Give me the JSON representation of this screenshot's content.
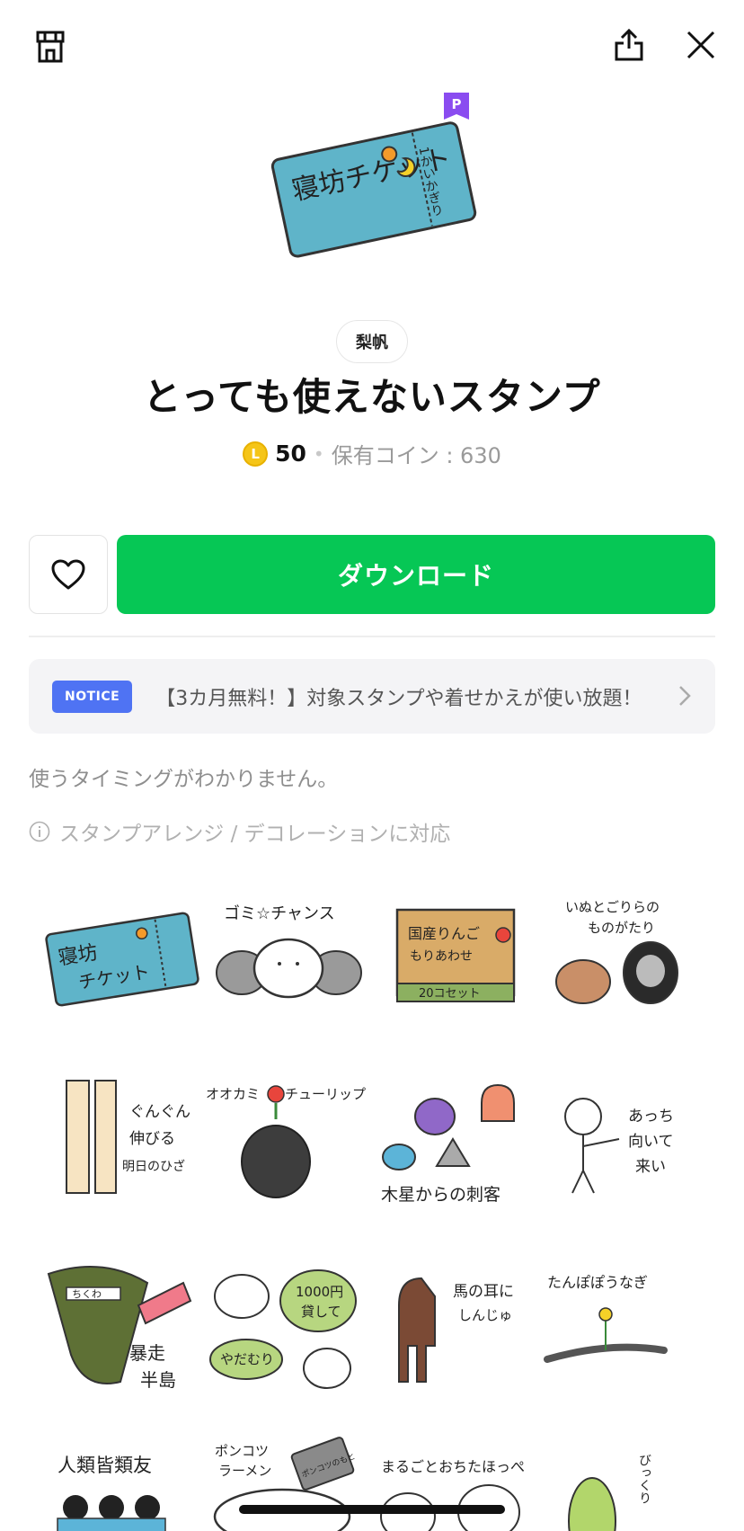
{
  "header": {
    "shop_icon": "shop-icon",
    "share_icon": "share-icon",
    "close_icon": "close-icon"
  },
  "product": {
    "premium_badge": "P",
    "hero_text_main": "寝坊チケット",
    "hero_text_side": "1かいかぎり",
    "author": "梨帆",
    "title": "とっても使えないスタンプ",
    "coin_letter": "L",
    "price": "50",
    "owned_coins": "保有コイン : 630"
  },
  "actions": {
    "favorite_icon": "heart-icon",
    "download_label": "ダウンロード"
  },
  "notice": {
    "tag": "NOTICE",
    "text": "【3カ月無料！】対象スタンプや着せかえが使い放題！"
  },
  "description": "使うタイミングがわかりません。",
  "info": "スタンプアレンジ / デコレーションに対応",
  "stickers": [
    {
      "t1": "寝坊",
      "t2": "チケット"
    },
    {
      "t1": "ゴミ☆チャンス",
      "t2": ""
    },
    {
      "t1": "国産りんご",
      "t2": "もりあわせ",
      "t3": "20コセット"
    },
    {
      "t1": "いぬとごりらの",
      "t2": "ものがたり"
    },
    {
      "t1": "ぐんぐん",
      "t2": "伸びる",
      "t3": "明日のひざ"
    },
    {
      "t1": "オオカミ",
      "t2": "チューリップ"
    },
    {
      "t1": "木星からの刺客",
      "t2": ""
    },
    {
      "t1": "あっち",
      "t2": "向いて",
      "t3": "来い"
    },
    {
      "t1": "ちくわ",
      "t2": "暴走",
      "t3": "半島"
    },
    {
      "t1": "1000円",
      "t2": "貸して",
      "t3": "やだむり"
    },
    {
      "t1": "馬の耳に",
      "t2": "しんじゅ"
    },
    {
      "t1": "たんぽぽうなぎ",
      "t2": ""
    },
    {
      "t1": "人類皆類友",
      "t2": ""
    },
    {
      "t1": "ポンコツ",
      "t2": "ラーメン",
      "t3": "ポンコツのもと"
    },
    {
      "t1": "まるごとおちたほっぺ",
      "t2": ""
    },
    {
      "t1": "びっくり",
      "t2": ""
    }
  ],
  "colors": {
    "download_green": "#06c755",
    "notice_blue": "#4f73f3",
    "premium_purple": "#8a4cf0",
    "coin_yellow": "#f5c518"
  }
}
